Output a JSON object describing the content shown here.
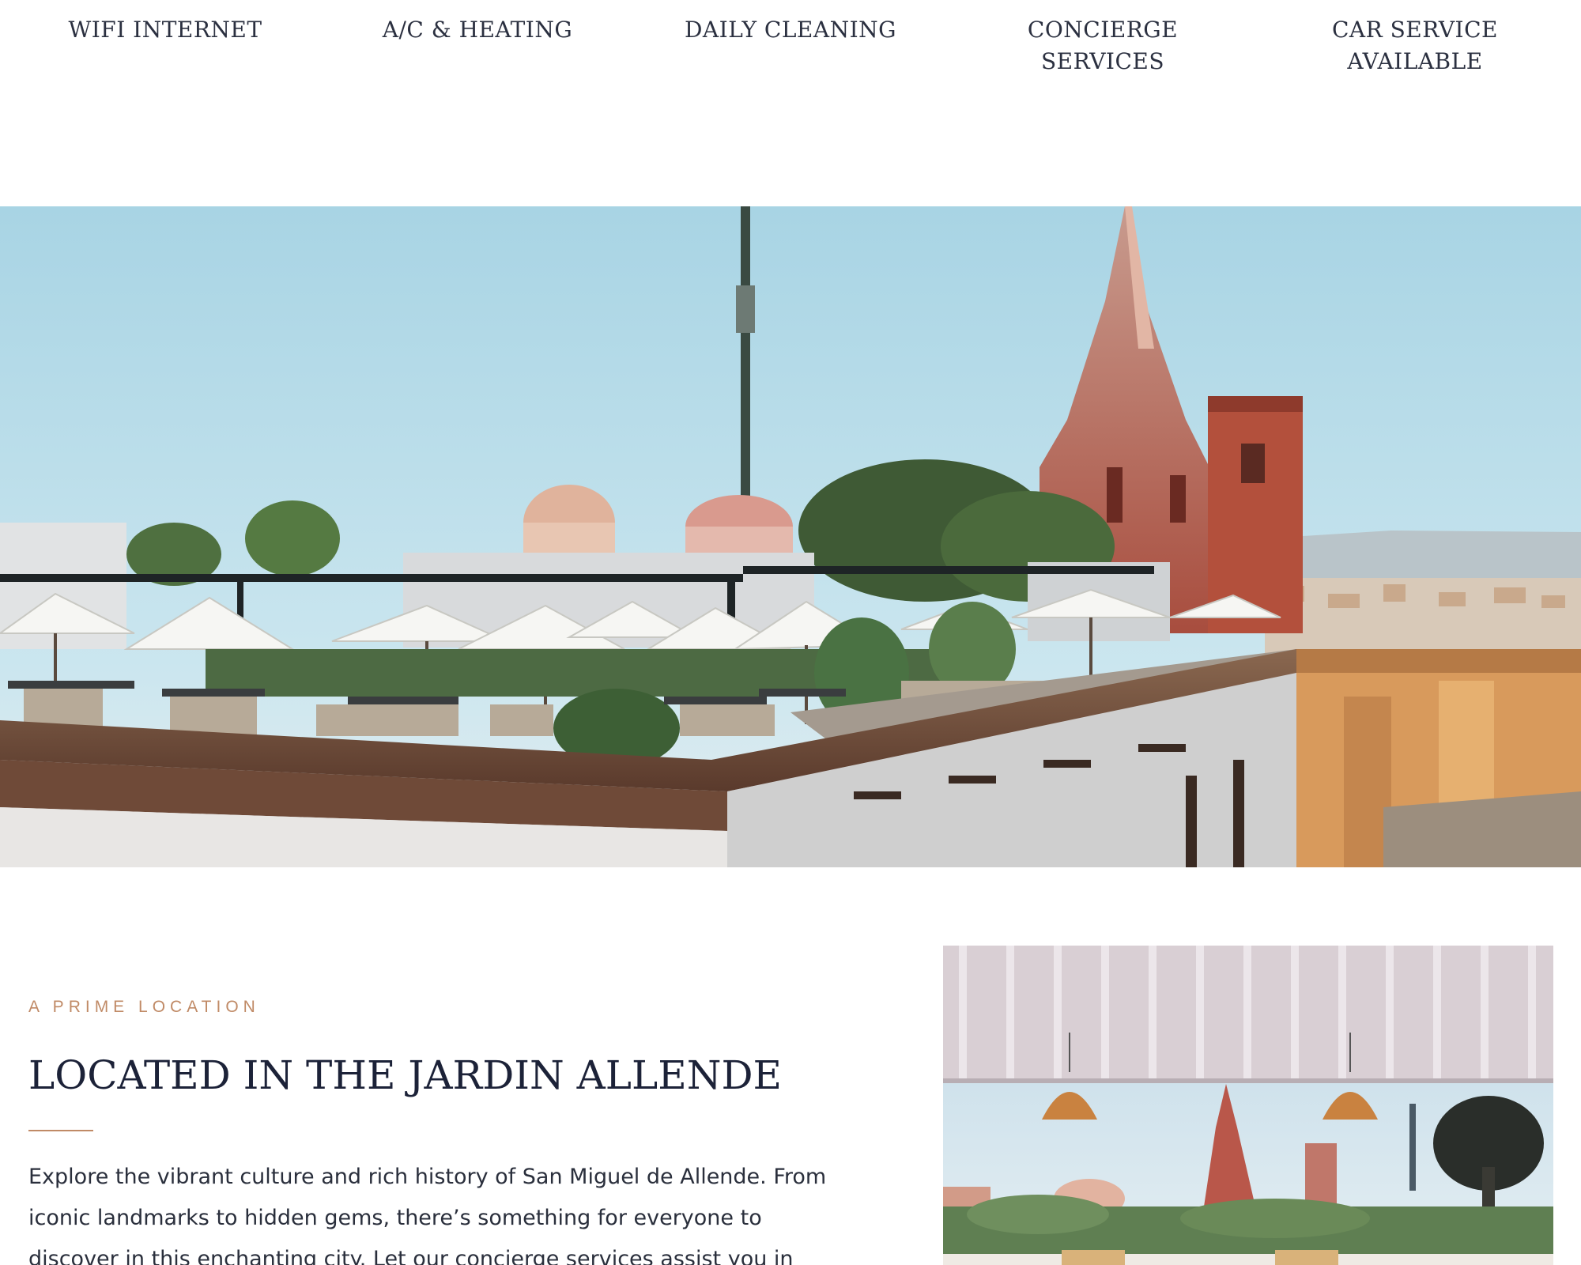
{
  "amenities": [
    {
      "lines": [
        "WIFI INTERNET"
      ]
    },
    {
      "lines": [
        "A/C & HEATING"
      ]
    },
    {
      "lines": [
        "DAILY CLEANING"
      ]
    },
    {
      "lines": [
        "CONCIERGE",
        "SERVICES"
      ]
    },
    {
      "lines": [
        "CAR SERVICE",
        "AVAILABLE"
      ]
    }
  ],
  "location": {
    "eyebrow": "A PRIME LOCATION",
    "title": "LOCATED IN THE JARDIN ALLENDE",
    "body": "Explore the vibrant culture and rich history of San Miguel de Allende. From iconic landmarks to hidden gems, there’s something for everyone to discover in this enchanting city. Let our concierge services assist you in planning the"
  },
  "colors": {
    "accent": "#c08a66",
    "heading": "#1c2238",
    "text": "#2a2f3c"
  }
}
